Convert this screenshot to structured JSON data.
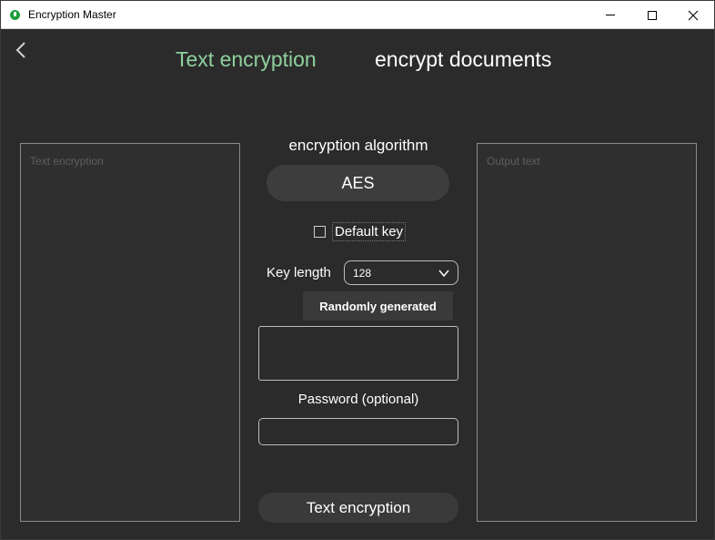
{
  "window": {
    "title": "Encryption Master",
    "icon": "app-icon",
    "controls": [
      "minimize-icon",
      "maximize-icon",
      "close-icon"
    ]
  },
  "nav": {
    "back_icon": "chevron-left-icon",
    "tabs": [
      {
        "label": "Text encryption",
        "active": true,
        "color": "#8fd19e"
      },
      {
        "label": "encrypt documents",
        "active": false,
        "color": "#ffffff"
      }
    ]
  },
  "input_panel": {
    "placeholder": "Text encryption"
  },
  "output_panel": {
    "placeholder": "Output text"
  },
  "algorithm": {
    "label": "encryption algorithm",
    "selected": "AES"
  },
  "default_key": {
    "label": "Default key",
    "checked": false
  },
  "key_length": {
    "label": "Key length",
    "selected": "128"
  },
  "random_button": {
    "label": "Randomly generated"
  },
  "key_field": {
    "value": ""
  },
  "password": {
    "label": "Password (optional)",
    "value": ""
  },
  "action_button": {
    "label": "Text encryption"
  },
  "colors": {
    "background": "#2b2b2b",
    "accent": "#8fd19e",
    "panel_border": "#8a8a8a"
  }
}
